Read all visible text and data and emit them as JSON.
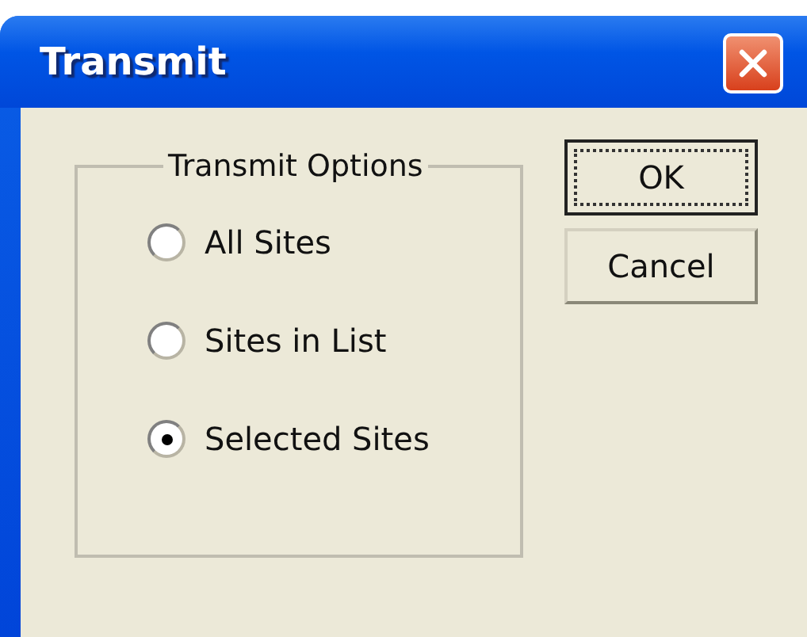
{
  "window": {
    "title": "Transmit"
  },
  "group": {
    "label": "Transmit Options",
    "options": [
      {
        "label": "All Sites",
        "selected": false
      },
      {
        "label": "Sites in List",
        "selected": false
      },
      {
        "label": "Selected Sites",
        "selected": true
      }
    ]
  },
  "buttons": [
    {
      "label": "OK",
      "focused": true
    },
    {
      "label": "Cancel",
      "focused": false
    }
  ]
}
